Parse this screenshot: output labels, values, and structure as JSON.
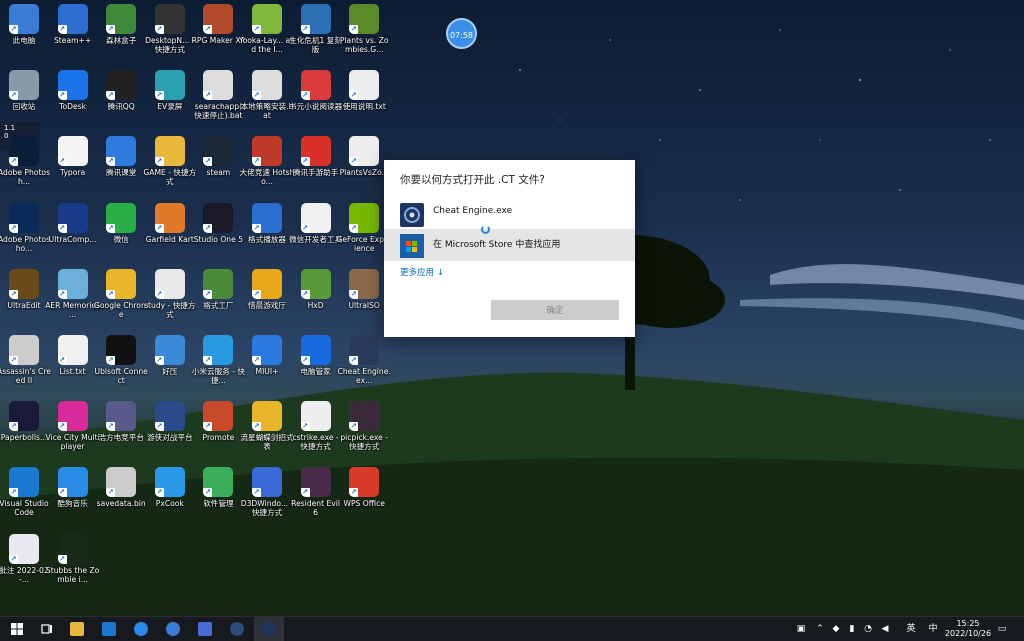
{
  "clock_bubble": "07:58",
  "side_widget": {
    "top": "1.1",
    "bottom": "0"
  },
  "desktop_icons": [
    {
      "label": "此电脑",
      "color": "#3a7bd5"
    },
    {
      "label": "Steam++",
      "color": "#2c6fd1"
    },
    {
      "label": "森林盒子",
      "color": "#3f8a3a"
    },
    {
      "label": "DesktopN... - 快捷方式",
      "color": "#333333"
    },
    {
      "label": "RPG Maker XP",
      "color": "#b04a2a"
    },
    {
      "label": "Yooka-Lay... and the I...",
      "color": "#7fb83a"
    },
    {
      "label": "生化危机1 复刻版",
      "color": "#2d6fb5"
    },
    {
      "label": "Plants vs. Zombies.G...",
      "color": "#5a8a2a"
    },
    {
      "label": "回收站",
      "color": "#8899aa"
    },
    {
      "label": "ToDesk",
      "color": "#1a73e8"
    },
    {
      "label": "腾讯QQ",
      "color": "#222222"
    },
    {
      "label": "EV录屏",
      "color": "#2aa0b0"
    },
    {
      "label": "searachapp( 快速停止).bat",
      "color": "#dddddd"
    },
    {
      "label": "本地策略安装.bat",
      "color": "#dddddd"
    },
    {
      "label": "书元小说阅读器",
      "color": "#d93a3a"
    },
    {
      "label": "使用说明.txt",
      "color": "#eeeeee"
    },
    {
      "label": "Adobe Photosh...",
      "color": "#0a1e3a"
    },
    {
      "label": "Typora",
      "color": "#f5f5f5"
    },
    {
      "label": "腾讯课堂",
      "color": "#2f7be0"
    },
    {
      "label": "GAME - 快捷方式",
      "color": "#e8b83a"
    },
    {
      "label": "steam",
      "color": "#1b2838"
    },
    {
      "label": "大佬竞速 Hotsho...",
      "color": "#c03a2a"
    },
    {
      "label": "腾讯手游助手",
      "color": "#d9302a"
    },
    {
      "label": "PlantsVsZo...",
      "color": "#eeeeee"
    },
    {
      "label": "Adobe Photosho...",
      "color": "#0a2a5a"
    },
    {
      "label": "UltraComp...",
      "color": "#1a3a8a"
    },
    {
      "label": "微信",
      "color": "#2aae48"
    },
    {
      "label": "Garfield Kart",
      "color": "#e07a2a"
    },
    {
      "label": "Studio One 5",
      "color": "#1a1a2a"
    },
    {
      "label": "格式播放器",
      "color": "#2a6fd0"
    },
    {
      "label": "微信开发者工具",
      "color": "#f0f0f0"
    },
    {
      "label": "GeForce Experience",
      "color": "#76b900"
    },
    {
      "label": "UltraEdit",
      "color": "#6a4a1a"
    },
    {
      "label": "AER Memories ...",
      "color": "#6ab0d8"
    },
    {
      "label": "Google Chrome",
      "color": "#e9b52a"
    },
    {
      "label": "study - 快捷方式",
      "color": "#e8e8e8"
    },
    {
      "label": "格式工厂",
      "color": "#4a8a3a"
    },
    {
      "label": "惜晨游戏厅",
      "color": "#e8a81a"
    },
    {
      "label": "HxD",
      "color": "#5a9a3a"
    },
    {
      "label": "UltraISO",
      "color": "#8a6a4a"
    },
    {
      "label": "Assassin's Creed II",
      "color": "#cccccc"
    },
    {
      "label": "List.txt",
      "color": "#f0f0f0"
    },
    {
      "label": "Ubisoft Connect",
      "color": "#111111"
    },
    {
      "label": "好压",
      "color": "#3a8ad8"
    },
    {
      "label": "小米云服务 - 快捷...",
      "color": "#2a9ae0"
    },
    {
      "label": "MIUI+",
      "color": "#2a7ae0"
    },
    {
      "label": "电脑管家",
      "color": "#1a6ae0"
    },
    {
      "label": "Cheat Engine.ex...",
      "color": "#2a3a5a"
    },
    {
      "label": "Paperbolls...",
      "color": "#1a1a3a"
    },
    {
      "label": "Vice City Multiplayer",
      "color": "#d82a9a"
    },
    {
      "label": "浩方电竞平台",
      "color": "#5a5a8a"
    },
    {
      "label": "游侠对战平台",
      "color": "#2a4a8a"
    },
    {
      "label": "Promote",
      "color": "#c84a2a"
    },
    {
      "label": "流星蝴蝶剑招式表",
      "color": "#e9b52a"
    },
    {
      "label": "cstrike.exe - 快捷方式",
      "color": "#eeeeee"
    },
    {
      "label": "picpick.exe - 快捷方式",
      "color": "#3a2a3a"
    },
    {
      "label": "Visual Studio Code",
      "color": "#1a7ad0"
    },
    {
      "label": "酷狗音乐",
      "color": "#2a8ae8"
    },
    {
      "label": "savedata.bin",
      "color": "#cccccc"
    },
    {
      "label": "PxCook",
      "color": "#2a9ae8"
    },
    {
      "label": "软件管理",
      "color": "#3aae5a"
    },
    {
      "label": "D3DWindo... - 快捷方式",
      "color": "#3a6ad8"
    },
    {
      "label": "Resident Evil 6",
      "color": "#4a2a4a"
    },
    {
      "label": "WPS Office",
      "color": "#d83a2a"
    },
    {
      "label": "批注 2022-02-...",
      "color": "#e8e8f0"
    },
    {
      "label": "Stubbs the Zombie i...",
      "color": "#1a2a1a"
    }
  ],
  "dialog": {
    "title": "你要以何方式打开此 .CT 文件?",
    "options": [
      {
        "label": "Cheat Engine.exe",
        "icon": "cheat-engine-icon"
      },
      {
        "label": "在 Microsoft Store 中查找应用",
        "icon": "microsoft-store-icon"
      }
    ],
    "more_apps": "更多应用 ↓",
    "ok": "确定"
  },
  "taskbar": {
    "apps": [
      "start-icon",
      "task-view-icon",
      "file-explorer-icon",
      "mail-icon",
      "kugou-icon",
      "gear-icon",
      "d3d-window-icon",
      "steam-icon",
      "cheat-engine-icon"
    ],
    "tray": {
      "lang": "英",
      "ime": "中",
      "time": "15:25",
      "date": "2022/10/26"
    }
  },
  "colors": {
    "accent": "#0067c0",
    "taskbar": "#161a1e",
    "dialog_selected": "#e5e5e5"
  }
}
